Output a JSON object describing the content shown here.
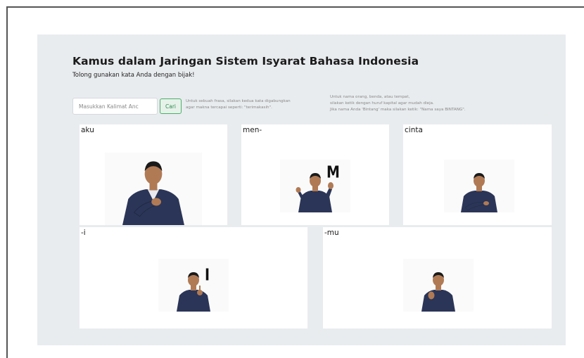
{
  "header": {
    "title": "Kamus dalam Jaringan Sistem Isyarat Bahasa Indonesia",
    "subtitle": "Tolong gunakan kata Anda dengan bijak!"
  },
  "search": {
    "placeholder": "Masukkan Kalimat Anc",
    "button_label": "Cari"
  },
  "hints": {
    "phrase": [
      "Untuk sebuah frasa, silakan kedua kata digabungkan",
      "agar makna tercapai seperti: \"terimakasih\"."
    ],
    "names": [
      "Untuk nama orang, benda, atau tempat,",
      "silakan ketik dengan huruf kapital agar mudah dieja.",
      "Jika nama Anda 'Bintang' maka silakan ketik: \"Nama saya BINTANG\"."
    ]
  },
  "cards": [
    {
      "label": "aku",
      "letter": "",
      "gesture": "hand-on-chest"
    },
    {
      "label": "men-",
      "letter": "M",
      "gesture": "fingerspell-m"
    },
    {
      "label": "cinta",
      "letter": "",
      "gesture": "hands-crossed"
    },
    {
      "label": "-i",
      "letter": "I",
      "gesture": "fingerspell-i"
    },
    {
      "label": "-mu",
      "letter": "",
      "gesture": "open-palm"
    }
  ],
  "colors": {
    "panel_bg": "#e9ecef",
    "button_green": "#4caf6a",
    "shirt": "#2b3557",
    "skin": "#b07a55",
    "hair": "#1a1a1a"
  }
}
